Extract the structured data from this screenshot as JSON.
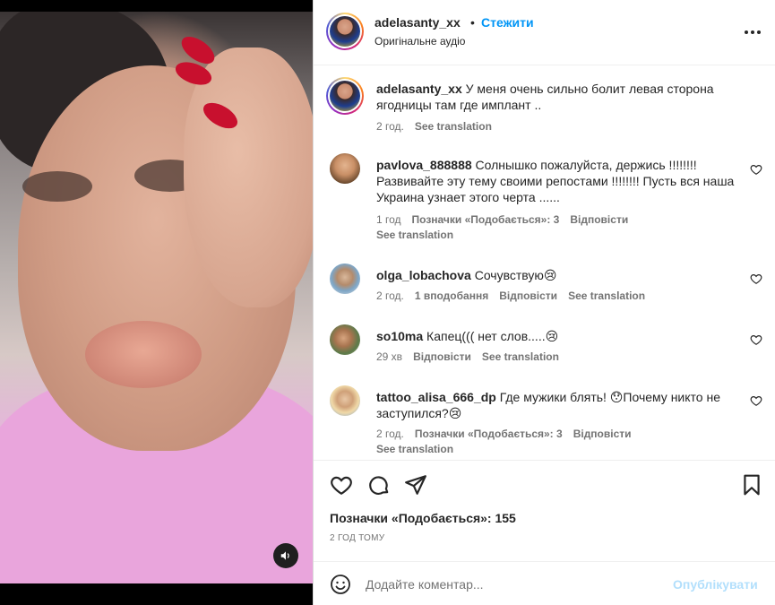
{
  "header": {
    "username": "adelasanty_xx",
    "dot": "•",
    "follow_label": "Стежити",
    "audio": "Оригінальне аудіо",
    "more_icon": "more-horizontal-icon"
  },
  "caption": {
    "username": "adelasanty_xx",
    "text": "У меня очень сильно болит левая сторона ягодницы там где имплант ..",
    "time": "2 год.",
    "see_translation": "See translation"
  },
  "comments": [
    {
      "username": "pavlova_888888",
      "text": "Солнышко пожалуйста, держись !!!!!!!! Развивайте эту тему своими репостами !!!!!!!! Пусть вся наша Украина узнает этого черта ......",
      "time": "1 год",
      "likes": "Позначки «Подобається»: 3",
      "reply": "Відповісти",
      "see_translation": "See translation"
    },
    {
      "username": "olga_lobachova",
      "text": "Сочувствую😢",
      "time": "2 год.",
      "likes": "1 вподобання",
      "reply": "Відповісти",
      "see_translation": "See translation"
    },
    {
      "username": "so10ma",
      "text": "Капец((( нет слов.....😢",
      "time": "29 хв",
      "reply": "Відповісти",
      "see_translation": "See translation"
    },
    {
      "username": "tattoo_alisa_666_dp",
      "text": "Где мужики блять! 😯Почему никто не заступился?😢",
      "time": "2 год.",
      "likes": "Позначки «Подобається»: 3",
      "reply": "Відповісти",
      "see_translation": "See translation"
    }
  ],
  "actions": {
    "like_icon": "heart-icon",
    "comment_icon": "comment-icon",
    "share_icon": "send-icon",
    "save_icon": "bookmark-icon"
  },
  "likes_count": "Позначки «Подобається»: 155",
  "post_time": "2 ГОД ТОМУ",
  "composer": {
    "placeholder": "Додайте коментар...",
    "publish_label": "Опублікувати",
    "emoji_icon": "emoji-icon"
  },
  "media": {
    "mute_icon": "speaker-icon"
  },
  "colors": {
    "accent": "#0095f6",
    "publish_disabled": "#b2dffc",
    "secondary_text": "#737373"
  }
}
